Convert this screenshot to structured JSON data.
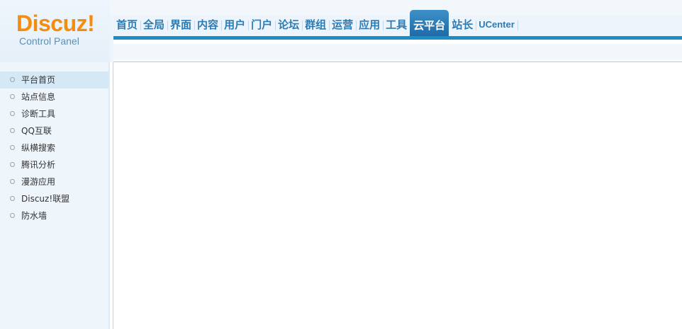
{
  "logo": {
    "brand": "Discuz!",
    "subtitle": "Control Panel"
  },
  "nav": {
    "items": [
      {
        "label": "首页",
        "name": "home"
      },
      {
        "label": "全局",
        "name": "global"
      },
      {
        "label": "界面",
        "name": "interface"
      },
      {
        "label": "内容",
        "name": "content"
      },
      {
        "label": "用户",
        "name": "users"
      },
      {
        "label": "门户",
        "name": "portal"
      },
      {
        "label": "论坛",
        "name": "forum"
      },
      {
        "label": "群组",
        "name": "groups"
      },
      {
        "label": "运营",
        "name": "operations"
      },
      {
        "label": "应用",
        "name": "apps"
      },
      {
        "label": "工具",
        "name": "tools"
      },
      {
        "label": "云平台",
        "name": "cloud-platform"
      },
      {
        "label": "站长",
        "name": "webmaster"
      },
      {
        "label": "UCenter",
        "name": "ucenter"
      }
    ],
    "active": "云平台"
  },
  "sidebar": {
    "items": [
      {
        "label": "平台首页"
      },
      {
        "label": "站点信息"
      },
      {
        "label": "诊断工具"
      },
      {
        "label": "QQ互联"
      },
      {
        "label": "纵横搜索"
      },
      {
        "label": "腾讯分析"
      },
      {
        "label": "漫游应用"
      },
      {
        "label": "Discuz!联盟"
      },
      {
        "label": "防水墙"
      }
    ],
    "active_index": 0
  },
  "colors": {
    "accent": "#1b8fc4",
    "brand_orange": "#f38d10",
    "nav_text": "#2b7cb4"
  }
}
